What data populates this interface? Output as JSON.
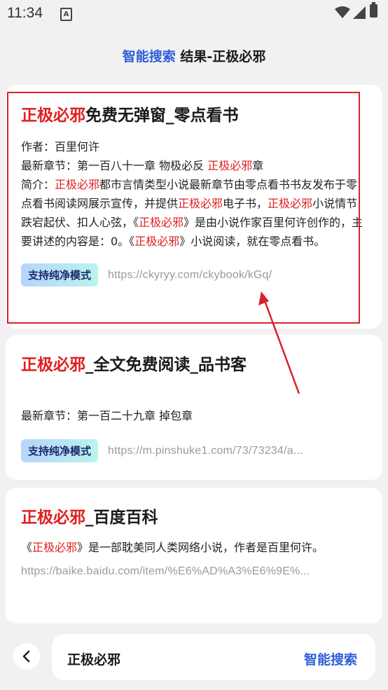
{
  "status_bar": {
    "time": "11:34",
    "notification_icon_letter": "A"
  },
  "header": {
    "brand": "智能搜索",
    "title": " 结果-正极必邪"
  },
  "results": [
    {
      "title_highlight": "正极必邪",
      "title_rest": "免费无弹窗_零点看书",
      "author_line": "作者：百里何许",
      "latest_prefix": "最新章节：第一百八十一章 物极必反 ",
      "latest_highlight": "正极必邪",
      "latest_suffix": "章",
      "summary_parts": [
        {
          "t": "简介：",
          "h": false
        },
        {
          "t": "正极必邪",
          "h": true
        },
        {
          "t": "都市言情类型小说最新章节由零点看书书友发布于零点看书阅读网展示宣传，并提供",
          "h": false
        },
        {
          "t": "正极必邪",
          "h": true
        },
        {
          "t": "电子书，",
          "h": false
        },
        {
          "t": "正极必邪",
          "h": true
        },
        {
          "t": "小说情节跌宕起伏、扣人心弦，《",
          "h": false
        },
        {
          "t": "正极必邪",
          "h": true
        },
        {
          "t": "》是由小说作家百里何许创作的，主要讲述的内容是：0。《",
          "h": false
        },
        {
          "t": "正极必邪",
          "h": true
        },
        {
          "t": "》小说阅读，就在零点看书。",
          "h": false
        }
      ],
      "tag": "支持纯净模式",
      "url": "https://ckyryy.com/ckybook/kGq/"
    },
    {
      "title_highlight": "正极必邪",
      "title_rest": "_全文免费阅读_品书客",
      "latest": "最新章节：第一百二十九章 掉包章",
      "tag": "支持纯净模式",
      "url": "https://m.pinshuke1.com/73/73234/a..."
    },
    {
      "title_highlight": "正极必邪",
      "title_rest": "_百度百科",
      "desc_pre": "《",
      "desc_highlight": "正极必邪",
      "desc_post": "》是一部耽美同人类网络小说，作者是百里何许。",
      "url": "https://baike.baidu.com/item/%E6%AD%A3%E6%9E%..."
    }
  ],
  "bottom_bar": {
    "query": "正极必邪",
    "search_label": "智能搜索"
  },
  "colors": {
    "accent": "#2f5fd8",
    "highlight": "#e01e1e",
    "annotation": "#d8232a"
  }
}
